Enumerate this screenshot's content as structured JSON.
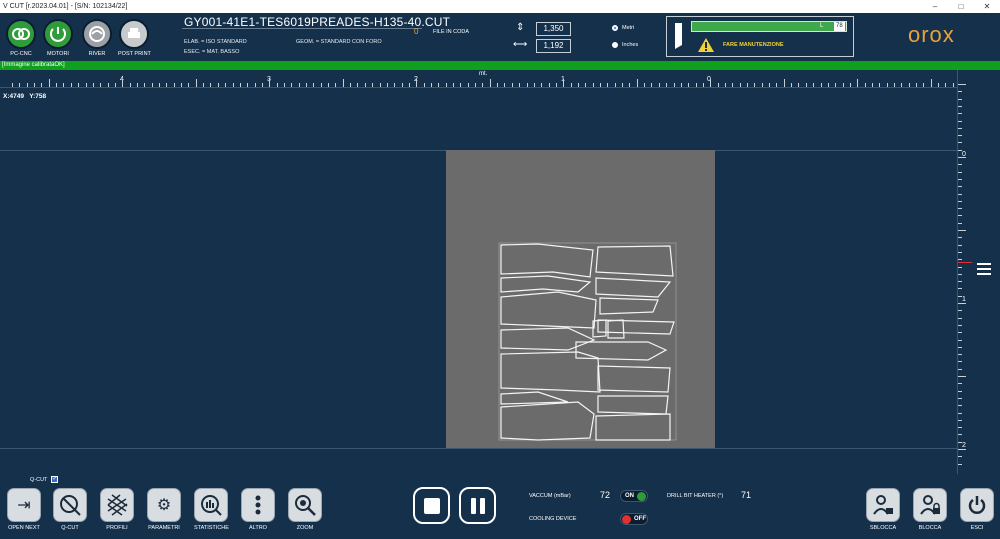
{
  "window": {
    "title": "V CUT [r.2023.04.01] - [S/N: 102134/22]",
    "minimize": "–",
    "maximize": "□",
    "close": "✕"
  },
  "header": {
    "buttons": [
      {
        "label": "PC-CNC",
        "icon": "link-icon",
        "state": "green"
      },
      {
        "label": "MOTORI",
        "icon": "motor-icon",
        "state": "green"
      },
      {
        "label": "RIVER",
        "icon": "river-icon",
        "state": "grey"
      },
      {
        "label": "POST PRINT",
        "icon": "printer-icon",
        "state": "lightgrey"
      }
    ],
    "filename": "GY001-41E1-TES6019PREADES-H135-40.CUT",
    "elab": "ELAB. = ISO STANDARD",
    "esec": "ESEC. = MAT. BASSO",
    "geom": "GEOM. = STANDARD CON FORO",
    "queue_count": "0",
    "queue_label": "FILE IN CODA",
    "height_value": "1,350",
    "width_value": "1,192",
    "unit_metri": "Metri",
    "unit_inches": "Inches",
    "selected_unit": "Metri",
    "maintenance_level_label": "L",
    "maintenance_level_value": "78",
    "maintenance_warning": "FARE MANUTENZIONE",
    "logo": "orox"
  },
  "status": {
    "message": "[Immagine calibrataOK]"
  },
  "ruler": {
    "unit": "mt.",
    "labels": [
      "4",
      "3",
      "2",
      "1",
      "0"
    ]
  },
  "coords": {
    "x": "X:4749",
    "y": "Y:758"
  },
  "vruler": {
    "labels": [
      "0",
      "1",
      "2"
    ]
  },
  "bottom": {
    "qcut_label": "Q-CUT",
    "qcut_checked": true,
    "tools": [
      {
        "label": "OPEN NEXT",
        "icon": "open-next-icon"
      },
      {
        "label": "Q-CUT",
        "icon": "qcut-icon"
      },
      {
        "label": "PROFILI",
        "icon": "profiles-icon"
      },
      {
        "label": "PARAMETRI",
        "icon": "gear-icon"
      },
      {
        "label": "STATISTICHE",
        "icon": "statistics-icon"
      },
      {
        "label": "ALTRO",
        "icon": "more-icon"
      },
      {
        "label": "ZOOM",
        "icon": "zoom-icon"
      }
    ],
    "vaccum_label": "VACCUM (mBar)",
    "vaccum_value": "72",
    "vaccum_toggle": "ON",
    "cooling_label": "COOLING DEVICE",
    "cooling_toggle": "OFF",
    "drill_label": "DRILL BIT HEATER (°)",
    "drill_value": "71",
    "right_buttons": [
      {
        "label": "SBLOCCA",
        "icon": "unlock-user-icon"
      },
      {
        "label": "BLOCCA",
        "icon": "lock-user-icon"
      },
      {
        "label": "ESCI",
        "icon": "power-icon"
      }
    ]
  },
  "colors": {
    "accent_green": "#0fa01d",
    "background": "#15304b",
    "logo": "#e8a23a",
    "warning": "#f2d135"
  }
}
